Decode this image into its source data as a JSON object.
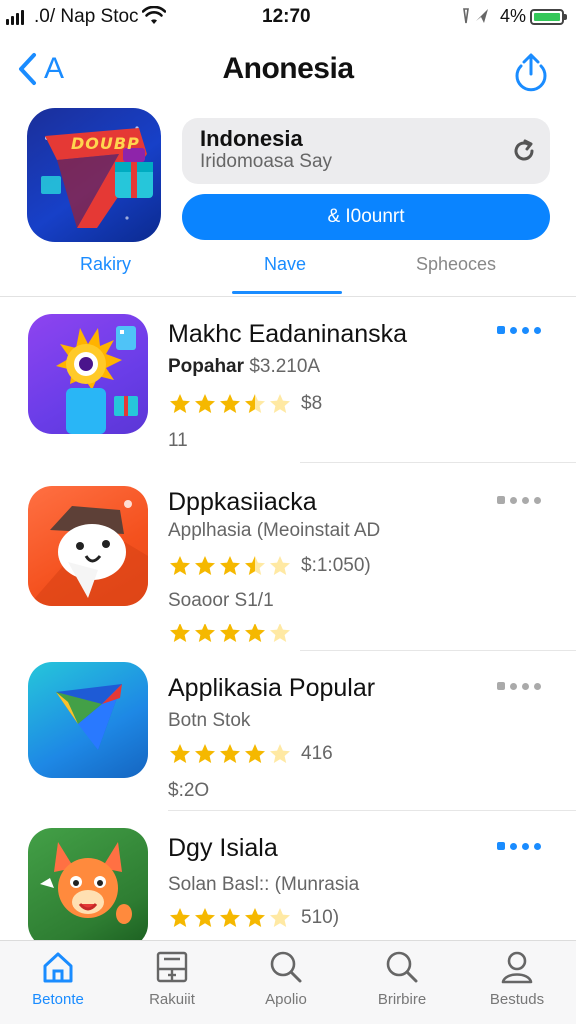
{
  "status_bar": {
    "carrier": ".0/ Nap Stoc",
    "time": "12:70",
    "battery_pct": "4%"
  },
  "nav": {
    "back_label": "A",
    "title": "Anonesia"
  },
  "hero": {
    "icon_text": "DOUBP",
    "card_title": "Indonesia",
    "card_subtitle": "Iridomoasa Say",
    "button_label": "& I0ounrt"
  },
  "segments": {
    "items": [
      "Rakiry",
      "Nave",
      "Spheoces"
    ],
    "active_index": 1
  },
  "apps": [
    {
      "title": "Makhc Eadaninanska",
      "subtitle_bold": "Popahar",
      "subtitle": "$3.210A",
      "rating": 3.5,
      "rating_text": "$8",
      "extra": "11",
      "more_color": "#1a8cff"
    },
    {
      "title": "Dppkasiiacka",
      "subtitle": "Applhasia (Meoinstait AD",
      "rating": 3.5,
      "rating_text": "$:1:050)",
      "extra": "Soaoor S1/1",
      "extra_rating": 4,
      "more_color": "#aaaaaa"
    },
    {
      "title": "Applikasia Popular",
      "subtitle": "Botn Stok",
      "rating": 4,
      "rating_text": "416",
      "extra": "$:2O",
      "more_color": "#aaaaaa"
    },
    {
      "title": "Dgy Isiala",
      "subtitle": "Solan Basl:: (Munrasia",
      "rating": 4,
      "rating_text": "510)",
      "more_color": "#1a8cff"
    }
  ],
  "tabbar": {
    "items": [
      {
        "label": "Betonte",
        "icon": "home-icon"
      },
      {
        "label": "Rakuiit",
        "icon": "board-icon"
      },
      {
        "label": "Apolio",
        "icon": "search-icon"
      },
      {
        "label": "Brirbire",
        "icon": "search-icon"
      },
      {
        "label": "Bestuds",
        "icon": "person-icon"
      }
    ],
    "active_index": 0
  },
  "colors": {
    "accent": "#1a8cff",
    "button": "#0a84ff",
    "star": "#f5b800",
    "battery": "#34c759"
  }
}
